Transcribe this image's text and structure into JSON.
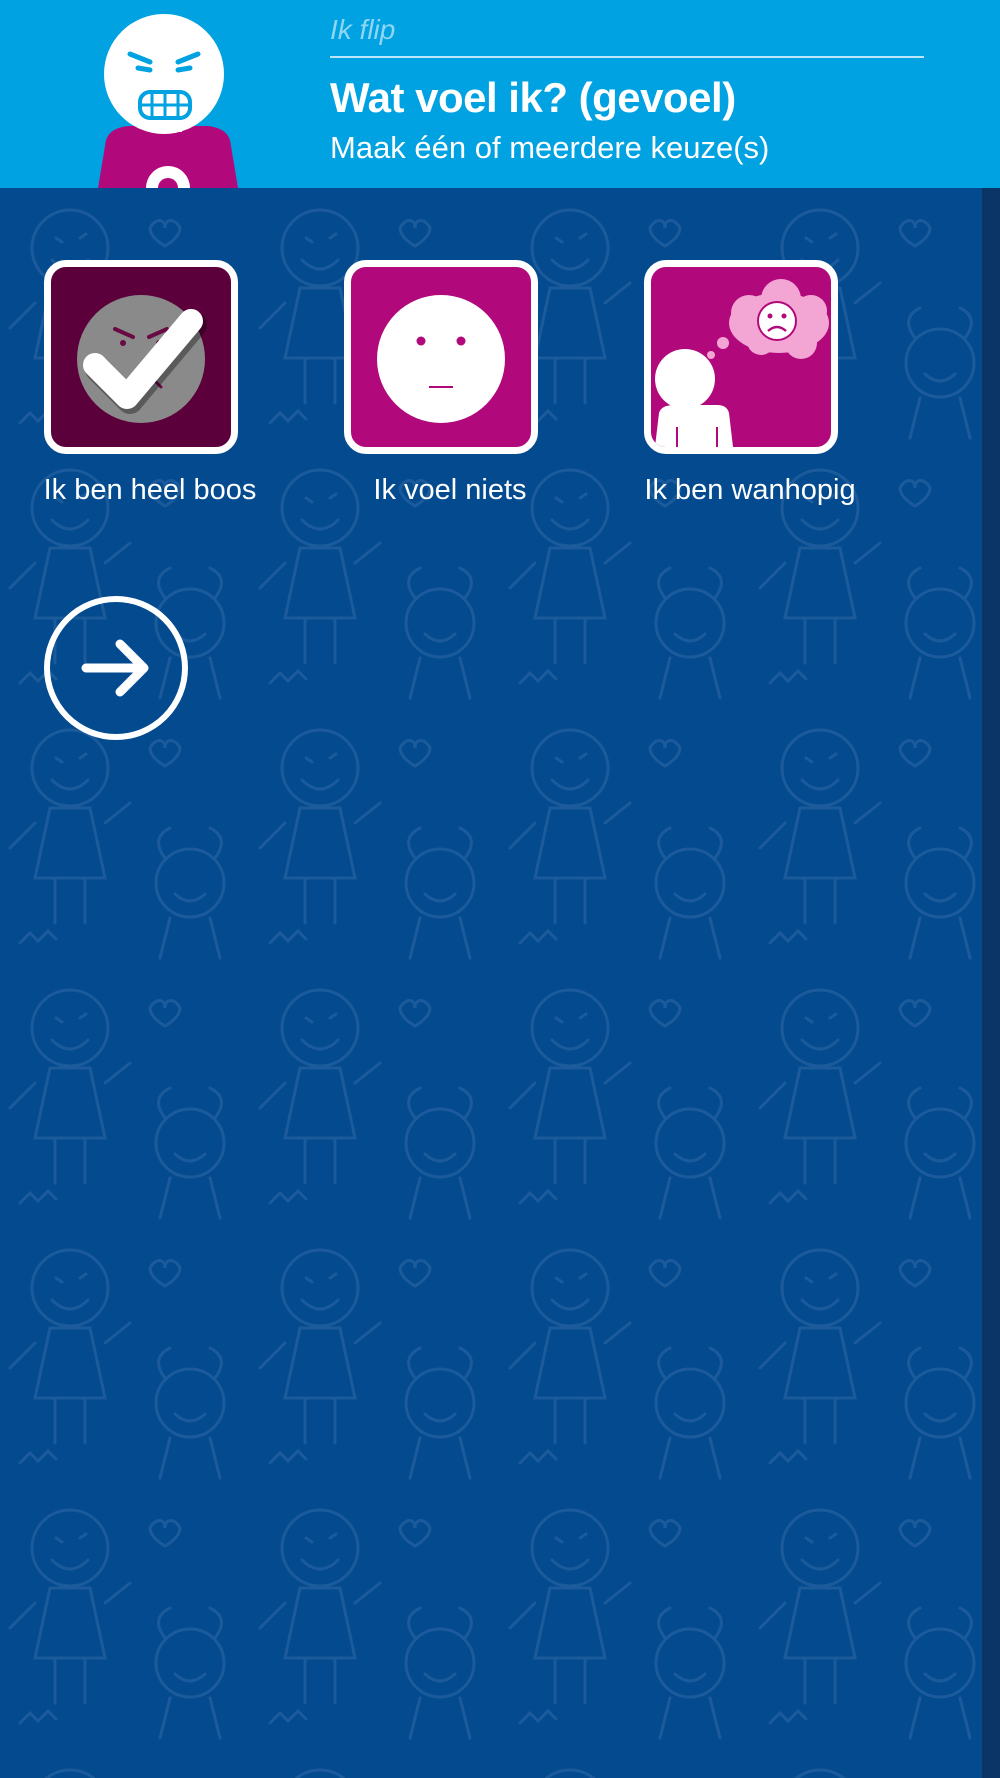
{
  "header": {
    "app_name": "Ik flip",
    "title": "Wat voel ik? (gevoel)",
    "subtitle": "Maak één of meerdere keuze(s)",
    "avatar_icon": "angry-child-avatar-icon"
  },
  "choices": [
    {
      "label": "Ik ben heel boos",
      "icon": "angry-face-icon",
      "selected": true
    },
    {
      "label": "Ik voel niets",
      "icon": "neutral-face-icon",
      "selected": false
    },
    {
      "label": "Ik ben wanhopig",
      "icon": "sad-thought-person-icon",
      "selected": false
    }
  ],
  "next_button": {
    "icon": "arrow-right-icon"
  },
  "colors": {
    "header_bg": "#00a2e2",
    "page_bg": "#034a8e",
    "tile_bg": "#b1097b",
    "tile_selected_bg": "#5c003b",
    "pattern_line": "#1e5e9e"
  }
}
